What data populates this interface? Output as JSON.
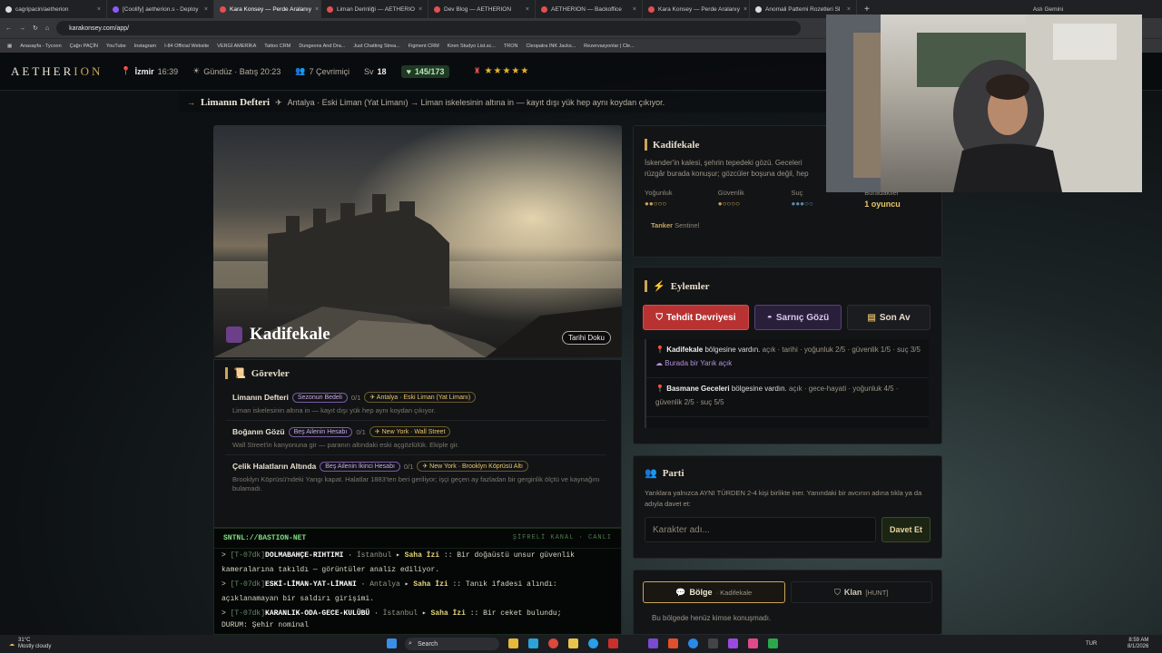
{
  "browser": {
    "tabs": [
      "cagripacin/aetherion",
      "[Coolify] aetherion.s - Deploy",
      "Kara Konsey — Perde Aralanıy",
      "Liman Derinliği — AETHERIO",
      "Dev Blog — AETHERION",
      "AETHERION — Backoffice",
      "Kara Konsey — Perde Aralanıy",
      "Anomali Pattemi Rozetleri Sl"
    ],
    "profile": "Aslı Gemini",
    "url": "karakonsey.com/app/",
    "bookmarks": [
      "Anasayfa - Tycoon",
      "Çağrı PAÇİN",
      "YouTube",
      "Instagram",
      "I-84 Official Website",
      "VERGİ AMERİKA",
      "Tattoo CRM",
      "Dungeons And Dra...",
      "Just Chatting Strea...",
      "Figment CRM",
      "Kiren Studyo List.sc...",
      "TRON",
      "Cleopatra INK Jacks...",
      "Rezervasyonlar | Cle..."
    ]
  },
  "app": {
    "logo_main": "AETHER",
    "logo_accent": "ION",
    "nav": {
      "city": "İzmir",
      "time": "16:39",
      "daylight": "Gündüz · Batış 20:23",
      "online": "7 Çevrimiçi",
      "level_label": "Sv",
      "level": "18",
      "hp": "145/173",
      "stars": "★★★★★"
    },
    "breadcrumb": {
      "title": "Limanın Defteri",
      "path": "Antalya · Eski Liman (Yat Limanı) → Liman iskelesinin altına in — kayıt dışı yük hep aynı koydan çıkıyor."
    },
    "hero": {
      "title": "Kadifekale",
      "button": "Tarihi Doku"
    },
    "quests": {
      "heading": "Görevler",
      "items": [
        {
          "name": "Limanın Defteri",
          "badge": "Sezonun Bedeli",
          "count": "0/1",
          "location": "Antalya · Eski Liman (Yat Limanı)",
          "desc": "Liman iskelesinin altına in — kayıt dışı yük hep aynı koydan çıkıyor."
        },
        {
          "name": "Boğanın Gözü",
          "badge": "Beş Ailenin Hesabı",
          "count": "0/1",
          "location": "New York · Wall Street",
          "desc": "Wall Street'in kanyonuna gir — paranın altındaki eski açgözlülük. Ekiple gir."
        },
        {
          "name": "Çelik Halatların Altında",
          "badge": "Beş Ailenin İkinci Hesabı",
          "count": "0/1",
          "location": "New York · Brooklyn Köprüsü Altı",
          "desc": "Brooklyn Köprüsü'ndeki Yangı kapat. Halatlar 1883'ten beri geriliyor; işçi geçen ay fazladan bir gerginlik ölçtü ve kaynağını bulamadı."
        }
      ]
    },
    "terminal": {
      "title": "SNTNL://BASTION-NET",
      "status": "ŞİFRELİ KANAL · CANLI",
      "lines": [
        {
          "time": "[T-07dk]",
          "place": "DOLMABAHÇE-RIHTIMI",
          "city": "İstanbul",
          "kind": "Saha İzi",
          "text": ":: Bir doğaüstü unsur güvenlik kameralarına takıldı — görüntüler analiz ediliyor."
        },
        {
          "time": "[T-07dk]",
          "place": "ESKİ-LİMAN-YAT-LİMANI",
          "city": "Antalya",
          "kind": "Saha İzi",
          "text": ":: Tanık ifadesi alındı: açıklanamayan bir saldırı girişimi."
        },
        {
          "time": "[T-07dk]",
          "place": "KARANLIK-ODA-GECE-KULÜBÜ",
          "city": "İstanbul",
          "kind": "Saha İzi",
          "text": ":: Bir ceket bulundu;"
        }
      ],
      "footer": "DURUM: Şehir nominal"
    },
    "zone": {
      "title": "Kadifekale",
      "desc": "İskender'in kalesi, şehrin tepedeki gözü. Geceleri rüzgâr burada konuşur; gözcüler boşuna değil, hep bir şey için gelmiyor.",
      "stats": [
        {
          "label": "Yoğunluk",
          "dots": "●●○○○"
        },
        {
          "label": "Güvenlik",
          "dots": "●○○○○"
        },
        {
          "label": "Suç",
          "dots": "●●●○○"
        },
        {
          "label": "Buradakiler",
          "value": "1 oyuncu"
        }
      ],
      "tag": "Tanker",
      "tag_sub": "Sentinel"
    },
    "actions": {
      "heading": "Eylemler",
      "buttons": [
        "Tehdit Devriyesi",
        "Sarnıç Gözü",
        "Son Av"
      ],
      "log": [
        {
          "place": "Kadifekale",
          "verb": "bölgesine vardın.",
          "meta": "açık · tarihi · yoğunluk 2/5 · güvenlik 1/5 · suç 3/5",
          "extra": "Burada bir Yarık açık"
        },
        {
          "place": "Basmane Geceleri",
          "verb": "bölgesine vardın.",
          "meta": "açık · gece-hayati · yoğunluk 4/5 · güvenlik 2/5 · suç 5/5",
          "extra": ""
        }
      ]
    },
    "party": {
      "heading": "Parti",
      "desc": "Yarıklara yalnızca AYNI TÜRDEN 2-4 kişi birlikte iner. Yanındaki bir avcının adına tıkla ya da adıyla davet et:",
      "placeholder": "Karakter adı...",
      "invite": "Davet Et"
    },
    "chat": {
      "tab_zone": "Bölge",
      "tab_zone_sub": "· Kadifekale",
      "tab_clan": "Klan",
      "tab_clan_sub": "[HUNT]",
      "empty": "Bu bölgede henüz kimse konuşmadı."
    }
  },
  "taskbar": {
    "weather": "31°C",
    "weather_desc": "Mostly cloudy",
    "search": "Search",
    "lang": "TUR",
    "time": "8:59 AM",
    "date": "8/1/2026"
  },
  "colors": {
    "accent": "#c9a55a",
    "danger": "#c93a3a",
    "purple": "#6b4a9a"
  }
}
